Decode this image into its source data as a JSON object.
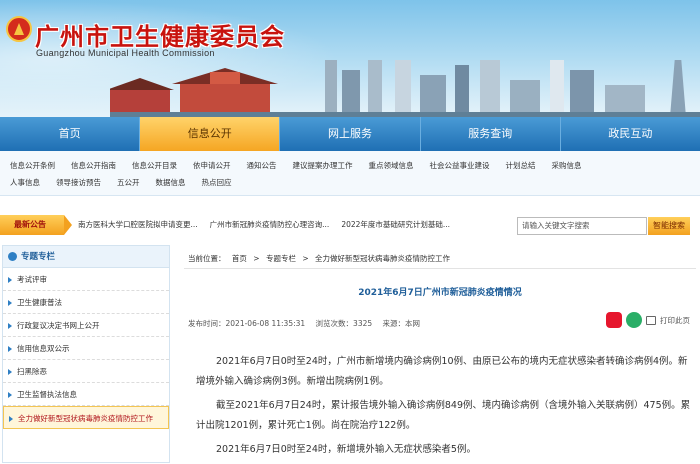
{
  "header": {
    "title": "广州市卫生健康委员会",
    "subtitle": "Guangzhou Municipal Health Commission"
  },
  "nav": [
    "首页",
    "信息公开",
    "网上服务",
    "服务查询",
    "政民互动"
  ],
  "subnav": {
    "row1": [
      "信息公开条例",
      "信息公开指南",
      "信息公开目录",
      "依申请公开",
      "通知公告",
      "建议提案办理工作",
      "重点领域信息",
      "社会公益事业建设",
      "计划总结",
      "采购信息"
    ],
    "row2": [
      "人事信息",
      "领导接访预告",
      "五公开",
      "数据信息",
      "热点回应"
    ]
  },
  "ticker": {
    "label": "最新公告",
    "items": [
      "南方医科大学口腔医院拟申请变更...",
      "广州市新冠肺炎疫情防控心理咨询...",
      "2022年度市基础研究计划基础..."
    ]
  },
  "search": {
    "placeholder": "请输入关键文字搜索",
    "button": "智能搜索"
  },
  "sidebar": {
    "title": "专题专栏",
    "items": [
      "考试评审",
      "卫生健康普法",
      "行政复议决定书网上公开",
      "信用信息双公示",
      "扫黑除恶",
      "卫生监督执法信息",
      "全力做好新型冠状病毒肺炎疫情防控工作"
    ]
  },
  "breadcrumb": {
    "label": "当前位置：",
    "items": [
      "首页",
      "专题专栏",
      "全力做好新型冠状病毒肺炎疫情防控工作"
    ],
    "sep": ">"
  },
  "article": {
    "title": "2021年6月7日广州市新冠肺炎疫情情况",
    "publish_label": "发布时间：",
    "publish_time": "2021-06-08 11:35:31",
    "views_label": "浏览次数：",
    "views": "3325",
    "source_label": "来源：",
    "source": "本网",
    "print": "打印此页",
    "paragraphs": [
      "2021年6月7日0时至24时，广州市新增境内确诊病例10例、由原已公布的境内无症状感染者转确诊病例4例。新增境外输入确诊病例3例。新增出院病例1例。",
      "截至2021年6月7日24时，累计报告境外输入确诊病例849例、境内确诊病例（含境外输入关联病例）475例。累计出院1201例，累计死亡1例。尚在院治疗122例。",
      "2021年6月7日0时至24时，新增境外输入无症状感染者5例。"
    ]
  },
  "colors": {
    "nav_blue": "#1f6fb4",
    "nav_active": "#f5a623",
    "title_red": "#c8130e",
    "link_blue": "#1f5e99"
  }
}
